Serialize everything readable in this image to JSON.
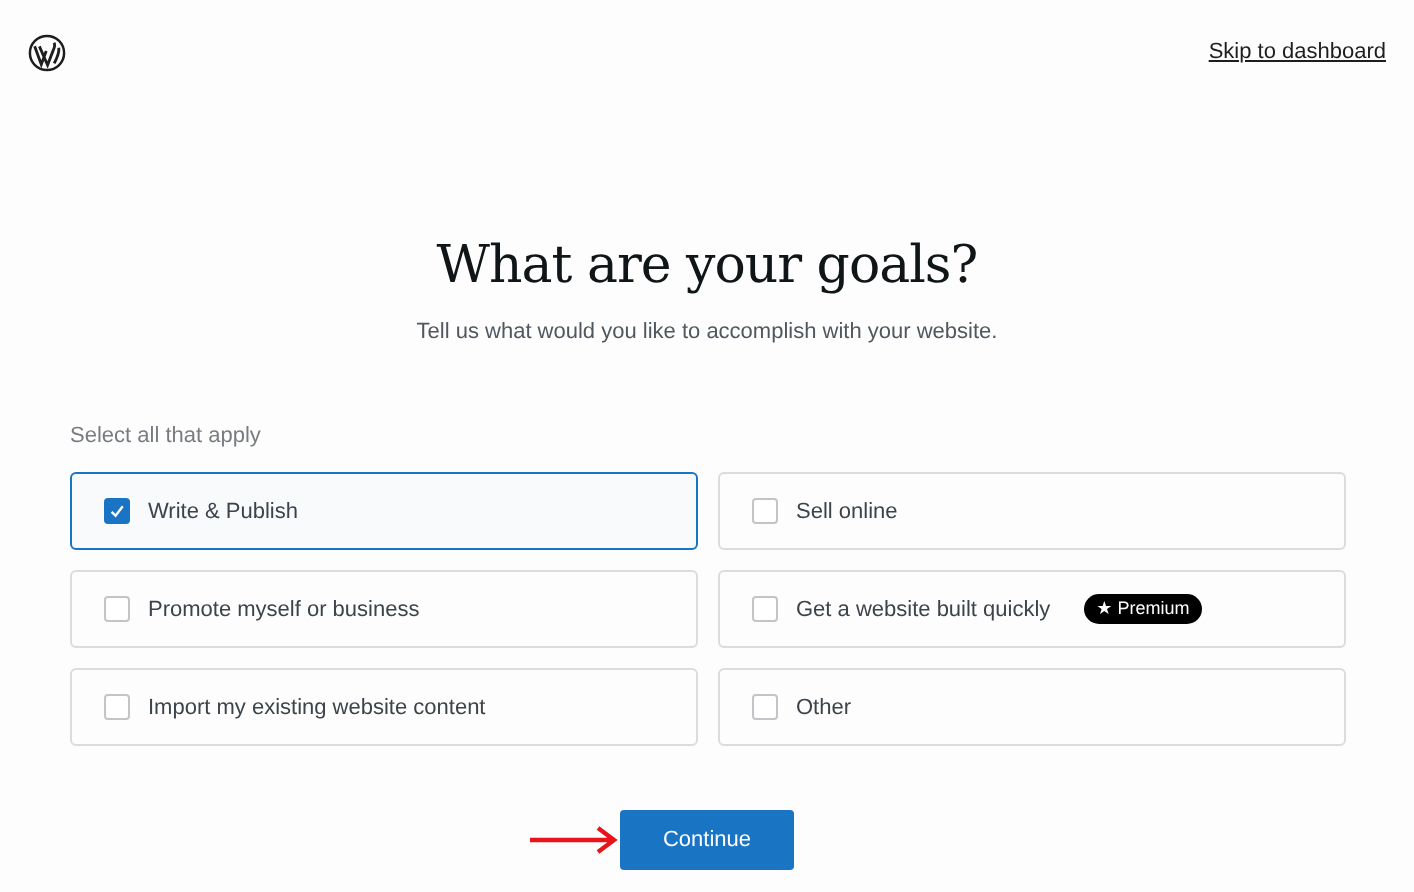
{
  "header": {
    "skip_link": "Skip to dashboard"
  },
  "heading": "What are your goals?",
  "subtitle": "Tell us what would you like to accomplish with your website.",
  "goals_label": "Select all that apply",
  "goals": [
    {
      "label": "Write & Publish",
      "checked": true
    },
    {
      "label": "Sell online",
      "checked": false
    },
    {
      "label": "Promote myself or business",
      "checked": false
    },
    {
      "label": "Get a website built quickly",
      "checked": false,
      "badge": "★ Premium"
    },
    {
      "label": "Import my existing website content",
      "checked": false
    },
    {
      "label": "Other",
      "checked": false
    }
  ],
  "continue_button": "Continue"
}
